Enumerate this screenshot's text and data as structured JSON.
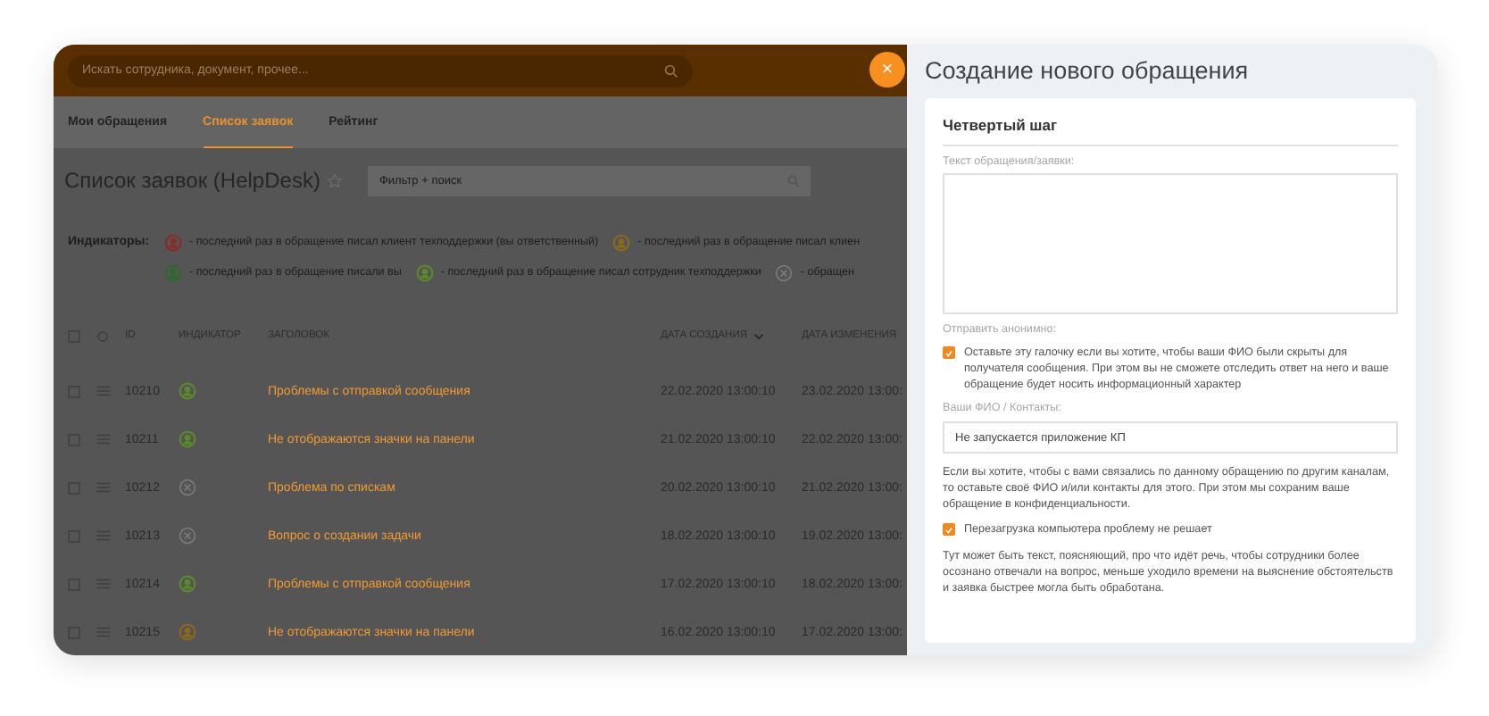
{
  "top_bar": {
    "search": {
      "placeholder": "Искать сотрудника, документ, прочее..."
    },
    "close": "×"
  },
  "tabs": [
    {
      "label": "Мои обращения",
      "selected": false
    },
    {
      "label": "Список заявок",
      "selected": true
    },
    {
      "label": "Рейтинг",
      "selected": false
    }
  ],
  "page_title": "Список заявок (HelpDesk)",
  "filter": {
    "placeholder": "Фильтр + поиск"
  },
  "indicators": {
    "label": "Индикаторы:",
    "lines": [
      [
        {
          "kind": "person",
          "color": "#8c2a2a",
          "text": "- последний раз в обращение писал клиент техподдержки (вы ответственный)"
        },
        {
          "kind": "person",
          "color": "#8a6a1a",
          "text": "- последний раз в обращение писал клиен"
        }
      ],
      [
        {
          "kind": "person",
          "color": "#2d6a2a",
          "text": "- последний раз в обращение писали вы"
        },
        {
          "kind": "person",
          "color": "#5a8a2a",
          "text": "- последний раз в обращение писал сотрудник техподдержки"
        },
        {
          "kind": "closed",
          "color": "#7a7a7a",
          "text": "- обращен"
        }
      ]
    ]
  },
  "table": {
    "all_checked": false,
    "columns": [
      {
        "label": "ID",
        "sorted": false
      },
      {
        "label": "ИНДИКАТОР",
        "sorted": false
      },
      {
        "label": "ЗАГОЛОВОК",
        "sorted": false
      },
      {
        "label": "ДАТА СОЗДАНИЯ",
        "sorted": true
      },
      {
        "label": "ДАТА ИЗМЕНЕНИЯ",
        "sorted": false
      }
    ],
    "rows": [
      {
        "checked": false,
        "id": "10210",
        "indicator": {
          "kind": "person",
          "color": "#5a8a2a"
        },
        "title": "Проблемы с отправкой сообщения",
        "created": "22.02.2020 13:00:10",
        "modified": "23.02.2020 13:00:"
      },
      {
        "checked": false,
        "id": "10211",
        "indicator": {
          "kind": "person",
          "color": "#5a8a2a"
        },
        "title": "Не отображаются значки на панели",
        "created": "21.02.2020 13:00:10",
        "modified": "22.02.2020 13:00:"
      },
      {
        "checked": false,
        "id": "10212",
        "indicator": {
          "kind": "closed",
          "color": "#7a7a7a"
        },
        "title": "Проблема по спискам",
        "created": "20.02.2020 13:00:10",
        "modified": "21.02.2020 13:00:"
      },
      {
        "checked": false,
        "id": "10213",
        "indicator": {
          "kind": "closed",
          "color": "#7a7a7a"
        },
        "title": "Вопрос о создании задачи",
        "created": "18.02.2020 13:00:10",
        "modified": "19.02.2020 13:00:"
      },
      {
        "checked": false,
        "id": "10214",
        "indicator": {
          "kind": "person",
          "color": "#5a8a2a"
        },
        "title": "Проблемы с отправкой сообщения",
        "created": "17.02.2020 13:00:10",
        "modified": "18.02.2020 13:00:"
      },
      {
        "checked": false,
        "id": "10215",
        "indicator": {
          "kind": "person",
          "color": "#8a6a1a"
        },
        "title": "Не отображаются значки на панели",
        "created": "16.02.2020 13:00:10",
        "modified": "17.02.2020 13:00:"
      }
    ]
  },
  "drawer": {
    "title": "Создание нового обращения",
    "step": "Четвертый шаг",
    "text_label": "Текст обращения/заявки:",
    "anonymous_label": "Отправить анонимно:",
    "anonymous": {
      "checked": true,
      "text": "Оставьте эту галочку если вы хотите, чтобы ваши ФИО были скрыты для получателя сообщения. При этом вы не сможете отследить ответ на него и ваше обращение будет носить информационный характер"
    },
    "contacts_label": "Ваши ФИО / Контакты:",
    "contacts_value": "Не запускается приложение КП",
    "contacts_hint": "Если вы хотите, чтобы с вами связались по данному обращению по другим каналам, то оставьте своё ФИО и/или контакты для этого. При этом мы сохраним ваше обращение в конфиденциальности.",
    "reboot": {
      "checked": true,
      "text": "Перезагрузка компьютера проблему не решает"
    },
    "note": "Тут может быть текст, поясняющий, про что идёт речь, чтобы сотрудники более осознано отвечали на вопрос, меньше уходило времени на выяснение обстоятельств и заявка быстрее могла быть обработана."
  }
}
